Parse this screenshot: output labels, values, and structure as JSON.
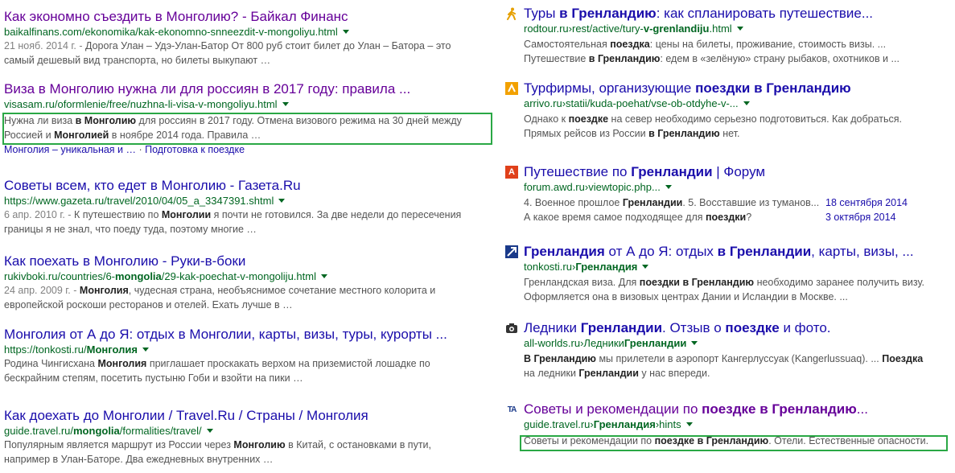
{
  "left_results": [
    {
      "title_plain": "Как экономно съездить в Монголию? - Байкал Финанс",
      "url": "baikalfinans.com/ekonomika/kak-ekonomno-snneezdit-v-mongoliyu.html",
      "date": "21 нояб. 2014 г. -",
      "snippet_l1": " Дорога Улан – Удэ-Улан-Батор От 800 руб стоит билет до Улан – Батора – это",
      "snippet_l2": "самый дешевый вид транспорта, но билеты выкупают …"
    },
    {
      "title_plain": "Виза в Монголию нужна ли для россиян в 2017 году: правила ...",
      "url": "visasam.ru/oformlenie/free/nuzhna-li-visa-v-mongoliyu.html",
      "snippet_l1_a": "Нужна ли виза ",
      "snippet_l1_b": "в Монголию",
      "snippet_l1_c": " для россиян в 2017 году. Отмена визового режима на 30 дней между",
      "snippet_l2_a": "Россией и ",
      "snippet_l2_b": "Монголией",
      "snippet_l2_c": " в ноябре 2014 года. Правила …",
      "sublink1": "Монголия – уникальная и …",
      "sublink_sep": " · ",
      "sublink2": "Подготовка к поездке"
    },
    {
      "title_plain": "Советы всем, кто едет в Монголию - Газета.Ru",
      "url": "https://www.gazeta.ru/travel/2010/04/05_a_3347391.shtml",
      "date": "6 апр. 2010 г. -",
      "snippet_l1_a": " К путешествию по ",
      "snippet_l1_b": "Монголии",
      "snippet_l1_c": " я почти не готовился. За две недели до пересечения",
      "snippet_l2": "границы я не знал, что поеду туда, поэтому многие …"
    },
    {
      "title_plain": "Как поехать в Монголию - Руки-в-боки",
      "url_a": "rukivboki.ru/countries/6-",
      "url_b": "mongolia",
      "url_c": "/29-kak-poechat-v-mongoliju.html",
      "date": "24 апр. 2009 г. -",
      "snippet_l1_b": "Монголия",
      "snippet_l1_c": ", чудесная страна, необъяснимое сочетание местного колорита и",
      "snippet_l2": "европейской роскоши ресторанов и отелей. Ехать лучше в …"
    },
    {
      "title_plain": "Монголия от А до Я: отдых в Монголии, карты, визы, туры, курорты ...",
      "url_a": "https://tonkosti.ru/",
      "url_b": "Монголия",
      "snippet_l1_a": "Родина Чингисхана ",
      "snippet_l1_b": "Монголия",
      "snippet_l1_c": " приглашает проскакать верхом на приземистой лошадке по",
      "snippet_l2": "бескрайним степям, посетить пустыню Гоби и взойти на пики …"
    },
    {
      "title_plain": "Как доехать до Монголии / Travel.Ru / Страны / Монголия",
      "url_a": "guide.travel.ru/",
      "url_b": "mongolia",
      "url_c": "/formalities/travel/",
      "snippet_l1_a": "Популярным является маршрут из России через ",
      "snippet_l1_b": "Монголию",
      "snippet_l1_c": " в Китай, с остановками в пути,",
      "snippet_l2": "например в Улан-Баторе. Два ежедневных внутренних …"
    }
  ],
  "right_results": [
    {
      "icon": "walking-person-icon",
      "icon_color": "#e6a000",
      "title_a": "Туры ",
      "title_b": "в Гренландию",
      "title_c": ": как спланировать путешествие...",
      "url_a": "rodtour.ru",
      "url_sep": " › ",
      "url_b": "rest/active/tury-",
      "url_c": "v-grenlandiju",
      "url_d": ".html",
      "snippet_l1_a": "Самостоятельная ",
      "snippet_l1_b": "поездка",
      "snippet_l1_c": ": цены на билеты, проживание, стоимость визы. ...",
      "snippet_l2_a": "Путешествие ",
      "snippet_l2_b": "в Гренландию",
      "snippet_l2_c": ": едем в «зелёную» страну рыбаков, охотников и ..."
    },
    {
      "icon": "arrivo-logo-icon",
      "icon_color": "#f2a100",
      "title_a": "Турфирмы, организующие ",
      "title_b": "поездки в Гренландию",
      "url_a": "arrivo.ru",
      "url_sep": " › ",
      "url_b": "statii/kuda-poehat/vse-ob-otdyhe-v-...",
      "snippet_l1_a": "Однако к ",
      "snippet_l1_b": "поездке",
      "snippet_l1_c": " на север необходимо серьезно подготовиться. Как добраться.",
      "snippet_l2_a": "Прямых рейсов из России ",
      "snippet_l2_b": "в Гренландию",
      "snippet_l2_c": " нет."
    },
    {
      "icon": "awd-logo-icon",
      "icon_color": "#e0401a",
      "icon_letter": "A",
      "title_a": "Путешествие по ",
      "title_b": "Гренландии",
      "title_c": " | Форум",
      "url_a": "forum.awd.ru",
      "url_sep": " › ",
      "url_b": "viewtopic.php...",
      "row1_a": "4. Военное прошлое ",
      "row1_b": "Гренландии",
      "row1_c": ". 5. Восставшие из туманов...",
      "row1_date": "18 сентября 2014",
      "row2_a": "А какое время самое подходящее для ",
      "row2_b": "поездки",
      "row2_c": "?",
      "row2_date": "3 октября 2014"
    },
    {
      "icon": "tonkosti-logo-icon",
      "icon_color": "#1a3a8a",
      "title_a": "Гренландия",
      "title_b": " от А до Я: отдых ",
      "title_c": "в Гренландии",
      "title_d": ", карты, визы, ...",
      "url_a": "tonkosti.ru",
      "url_sep": " › ",
      "url_b": "Гренландия",
      "snippet_l1_a": "Гренландская виза. Для ",
      "snippet_l1_b": "поездки в Гренландию",
      "snippet_l1_c": " необходимо заранее получить визу.",
      "snippet_l2": "Оформляется она в визовых центрах Дании и Исландии в Москве. ..."
    },
    {
      "icon": "allworlds-logo-icon",
      "icon_color": "#333333",
      "title_a": "Ледники ",
      "title_b": "Гренландии",
      "title_c": ". Отзыв о ",
      "title_d": "поездке",
      "title_e": " и фото.",
      "url_a": "all-worlds.ru",
      "url_sep": " › ",
      "url_b": "Ледники ",
      "url_c": "Гренландии",
      "snippet_l1_b": "В Гренландию",
      "snippet_l1_c": " мы прилетели в аэропорт Кангерлуссуак (Kangerlussuaq). ... ",
      "snippet_l1_d": "Поездка",
      "snippet_l2_a": "на ледники ",
      "snippet_l2_b": "Гренландии",
      "snippet_l2_c": " у нас впереди."
    },
    {
      "icon": "travelru-logo-icon",
      "icon_color": "#1a3a8a",
      "icon_letter": "TA",
      "title_a": "Советы и рекомендации по ",
      "title_b": "поездке в Гренландию",
      "title_c": "...",
      "url_a": "guide.travel.ru",
      "url_sep": " › ",
      "url_b": "Гренландия",
      "url_c": "hints",
      "snippet_l1_a": "Советы и рекомендации по ",
      "snippet_l1_b": "поездке в Гренландию",
      "snippet_l1_c": ". Отели. Естественные опасности."
    }
  ],
  "colors": {
    "link": "#1a0dab",
    "visited": "#660099",
    "url": "#006621",
    "snippet": "#545454",
    "highlight_box": "#2aa845"
  }
}
